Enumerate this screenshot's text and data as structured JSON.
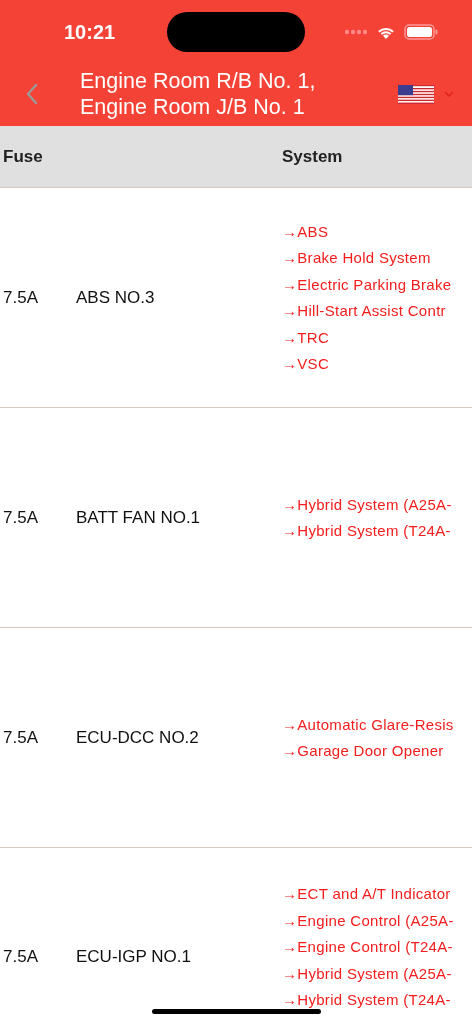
{
  "status_bar": {
    "time": "10:21"
  },
  "nav": {
    "title_lines": [
      "Engine Room R/B No. 1,",
      "Engine Room J/B No. 1"
    ]
  },
  "table": {
    "columns": [
      "Fuse",
      "System"
    ],
    "rows": [
      {
        "amperage": "7.5A",
        "name": "ABS NO.3",
        "systems": [
          "→ABS",
          "→Brake Hold System",
          "→Electric Parking Brake",
          "→Hill-Start Assist Contr",
          "→TRC",
          "→VSC"
        ]
      },
      {
        "amperage": "7.5A",
        "name": "BATT FAN NO.1",
        "systems": [
          "→Hybrid System (A25A-",
          "→Hybrid System (T24A-"
        ]
      },
      {
        "amperage": "7.5A",
        "name": "ECU-DCC NO.2",
        "systems": [
          "→Automatic Glare-Resis",
          "→Garage Door Opener"
        ]
      },
      {
        "amperage": "7.5A",
        "name": "ECU-IGP NO.1",
        "systems": [
          "→ECT and A/T Indicator",
          "→Engine Control (A25A-",
          "→Engine Control (T24A-",
          "→Hybrid System (A25A-",
          "→Hybrid System (T24A-"
        ]
      }
    ]
  }
}
